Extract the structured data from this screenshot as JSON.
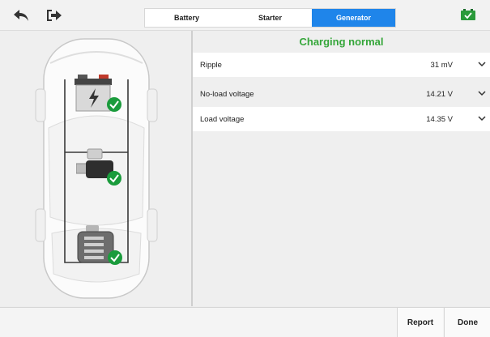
{
  "toolbar": {
    "back_icon": "back-arrow-icon",
    "exit_icon": "exit-icon",
    "battery_status_icon": "battery-ok-icon"
  },
  "tabs": [
    {
      "label": "Battery",
      "active": false
    },
    {
      "label": "Starter",
      "active": false
    },
    {
      "label": "Generator",
      "active": true
    }
  ],
  "colors": {
    "accent": "#1f85ea",
    "success": "#35a63a",
    "check": "#1a9b3c"
  },
  "status_text": "Charging normal",
  "measurements": [
    {
      "label": "Ripple",
      "value": "31 mV"
    },
    {
      "label": "No-load voltage",
      "value": "14.21 V"
    },
    {
      "label": "Load voltage",
      "value": "14.35 V"
    }
  ],
  "footer": {
    "report_label": "Report",
    "done_label": "Done"
  }
}
